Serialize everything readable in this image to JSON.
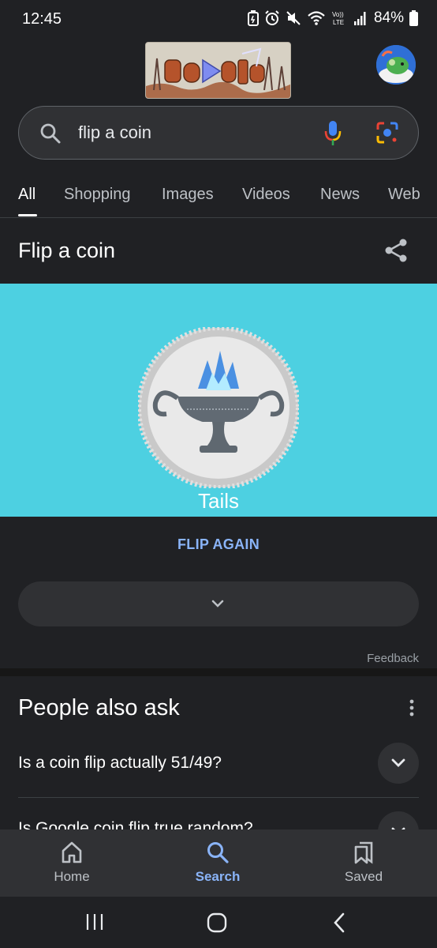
{
  "status_bar": {
    "time": "12:45",
    "battery_percent": "84%",
    "icons": [
      "battery-saver-icon",
      "alarm-icon",
      "mute-icon",
      "wifi-icon",
      "volte-icon",
      "signal-icon",
      "battery-icon"
    ],
    "volte_label": "Vo)) LTE"
  },
  "header": {
    "doodle_name": "google-doodle",
    "avatar_name": "account-avatar"
  },
  "search": {
    "query": "flip a coin",
    "icons": [
      "search-icon",
      "mic-icon",
      "lens-icon"
    ]
  },
  "tabs": [
    {
      "label": "All",
      "active": true
    },
    {
      "label": "Shopping",
      "active": false
    },
    {
      "label": "Images",
      "active": false
    },
    {
      "label": "Videos",
      "active": false
    },
    {
      "label": "News",
      "active": false
    },
    {
      "label": "Web",
      "active": false
    }
  ],
  "coin_card": {
    "title": "Flip a coin",
    "result": "Tails",
    "flip_again_label": "FLIP AGAIN",
    "feedback_label": "Feedback",
    "background_color": "#4dd0e1"
  },
  "people_also_ask": {
    "title": "People also ask",
    "questions": [
      "Is a coin flip actually 51/49?",
      "Is Google coin flip true random?"
    ]
  },
  "bottom_nav": [
    {
      "label": "Home",
      "icon": "home-icon",
      "active": false
    },
    {
      "label": "Search",
      "icon": "search-icon",
      "active": true
    },
    {
      "label": "Saved",
      "icon": "saved-icon",
      "active": false
    }
  ],
  "colors": {
    "background": "#202124",
    "accent": "#8ab4f8",
    "surface": "#303134"
  }
}
